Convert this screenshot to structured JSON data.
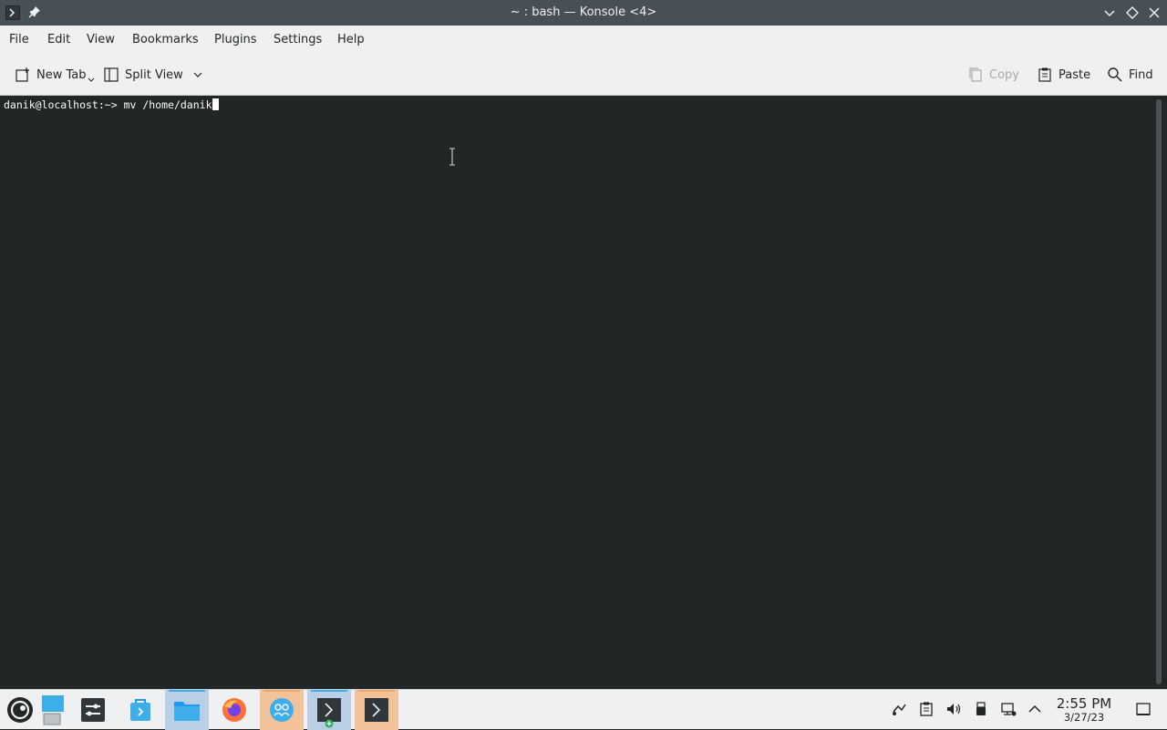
{
  "window": {
    "title": "~ : bash — Konsole <4>"
  },
  "menu": [
    "File",
    "Edit",
    "View",
    "Bookmarks",
    "Plugins",
    "Settings",
    "Help"
  ],
  "toolbar": {
    "new_tab": "New Tab",
    "split_view": "Split View",
    "copy": "Copy",
    "paste": "Paste",
    "find": "Find"
  },
  "terminal": {
    "prompt": "danik@localhost:~> ",
    "command": "mv /home/danik"
  },
  "taskbar": {
    "apps": [
      "start-menu",
      "desktop-pager",
      "system-settings",
      "discover",
      "file-manager",
      "firefox",
      "kde-connect",
      "konsole",
      "konsole"
    ],
    "clock_time": "2:55 PM",
    "clock_date": "3/27/23"
  },
  "colors": {
    "titlebar": "#475057",
    "terminal_bg": "#232627",
    "accent": "#3daee9"
  }
}
